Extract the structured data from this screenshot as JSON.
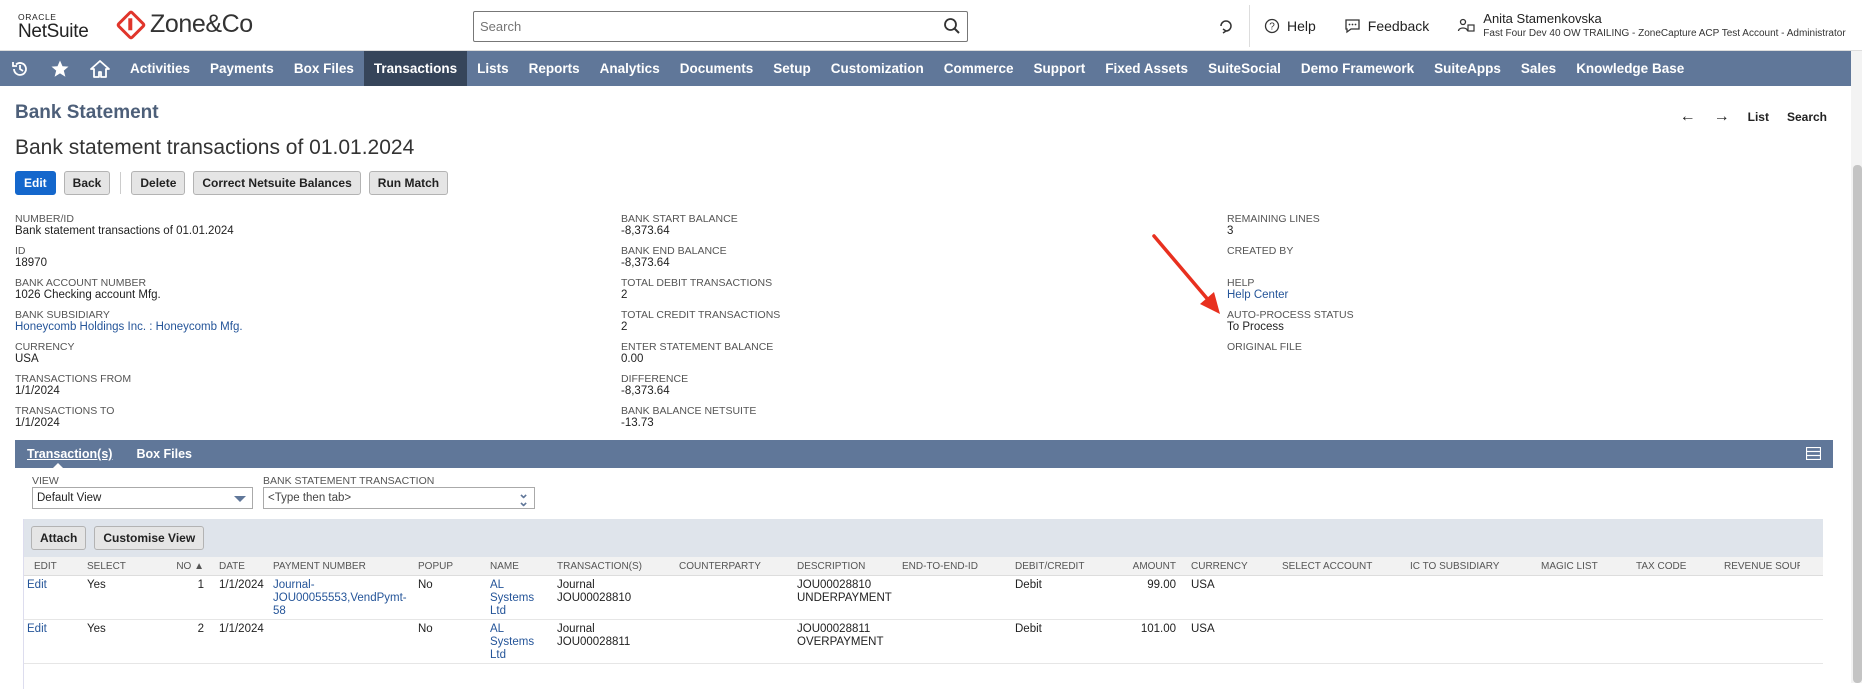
{
  "header": {
    "oracle_label": "ORACLE",
    "netsuite_label": "NetSuite",
    "company_logo": "Zone&Co",
    "search_placeholder": "Search",
    "help_label": "Help",
    "feedback_label": "Feedback",
    "user_name": "Anita Stamenkovska",
    "user_account": "Fast Four Dev 40 OW TRAILING - ZoneCapture ACP Test Account - Administrator"
  },
  "nav": {
    "items": [
      "Activities",
      "Payments",
      "Box Files",
      "Transactions",
      "Lists",
      "Reports",
      "Analytics",
      "Documents",
      "Setup",
      "Customization",
      "Commerce",
      "Support",
      "Fixed Assets",
      "SuiteSocial",
      "Demo Framework",
      "SuiteApps",
      "Sales",
      "Knowledge Base"
    ],
    "active": "Transactions"
  },
  "page": {
    "record_type": "Bank Statement",
    "title": "Bank statement transactions of 01.01.2024",
    "list_label": "List",
    "search_label": "Search",
    "buttons": {
      "edit": "Edit",
      "back": "Back",
      "delete": "Delete",
      "correct": "Correct Netsuite Balances",
      "run_match": "Run Match"
    }
  },
  "fields": {
    "col1": [
      {
        "label": "NUMBER/ID",
        "value": "Bank statement transactions of 01.01.2024"
      },
      {
        "label": "ID",
        "value": "18970"
      },
      {
        "label": "BANK ACCOUNT NUMBER",
        "value": "1026 Checking account Mfg."
      },
      {
        "label": "BANK SUBSIDIARY",
        "value": "Honeycomb Holdings Inc. : Honeycomb Mfg."
      },
      {
        "label": "CURRENCY",
        "value": "USA"
      },
      {
        "label": "TRANSACTIONS FROM",
        "value": "1/1/2024"
      },
      {
        "label": "TRANSACTIONS TO",
        "value": "1/1/2024"
      }
    ],
    "col2": [
      {
        "label": "BANK START BALANCE",
        "value": "-8,373.64"
      },
      {
        "label": "BANK END BALANCE",
        "value": "-8,373.64"
      },
      {
        "label": "TOTAL DEBIT TRANSACTIONS",
        "value": "2"
      },
      {
        "label": "TOTAL CREDIT TRANSACTIONS",
        "value": "2"
      },
      {
        "label": "ENTER STATEMENT BALANCE",
        "value": "0.00"
      },
      {
        "label": "DIFFERENCE",
        "value": "-8,373.64"
      },
      {
        "label": "BANK BALANCE NETSUITE",
        "value": "-13.73"
      }
    ],
    "col3": [
      {
        "label": "REMAINING LINES",
        "value": "3"
      },
      {
        "label": "CREATED BY",
        "value": ""
      },
      {
        "label": "HELP",
        "value": "Help Center"
      },
      {
        "label": "AUTO-PROCESS STATUS",
        "value": "To Process"
      },
      {
        "label": "ORIGINAL FILE",
        "value": ""
      }
    ]
  },
  "sublist": {
    "tabs": [
      "Transaction(s)",
      "Box Files"
    ],
    "view_label": "VIEW",
    "view_value": "Default View",
    "bst_label": "BANK STATEMENT TRANSACTION",
    "bst_placeholder": "<Type then tab>",
    "attach_label": "Attach",
    "customise_label": "Customise View",
    "columns": [
      "EDIT",
      "SELECT",
      "NO ▲",
      "DATE",
      "PAYMENT NUMBER",
      "POPUP",
      "NAME",
      "TRANSACTION(S)",
      "COUNTERPARTY",
      "DESCRIPTION",
      "END-TO-END-ID",
      "DEBIT/CREDIT",
      "AMOUNT",
      "CURRENCY",
      "SELECT ACCOUNT",
      "IC TO SUBSIDIARY",
      "MAGIC LIST",
      "TAX CODE",
      "REVENUE SOURCE"
    ],
    "rows": [
      {
        "edit": "Edit",
        "select": "Yes",
        "no": "1",
        "date": "1/1/2024",
        "payment_number": "Journal-\nJOU00055553,VendPymt-\n58",
        "popup": "No",
        "name": "AL\nSystems\nLtd",
        "transactions": "Journal\nJOU00028810",
        "counterparty": "",
        "description": "JOU00028810\nUNDERPAYMENT",
        "e2e": "",
        "debit_credit": "Debit",
        "amount": "99.00",
        "currency": "USA"
      },
      {
        "edit": "Edit",
        "select": "Yes",
        "no": "2",
        "date": "1/1/2024",
        "payment_number": "",
        "popup": "No",
        "name": "AL\nSystems\nLtd",
        "transactions": "Journal\nJOU00028811",
        "counterparty": "",
        "description": "JOU00028811\nOVERPAYMENT",
        "e2e": "",
        "debit_credit": "Debit",
        "amount": "101.00",
        "currency": "USA"
      }
    ]
  },
  "colors": {
    "nav_bg": "#607799",
    "nav_active": "#36455a",
    "primary": "#1467cc",
    "brand_red": "#e0352b",
    "link": "#255599"
  }
}
